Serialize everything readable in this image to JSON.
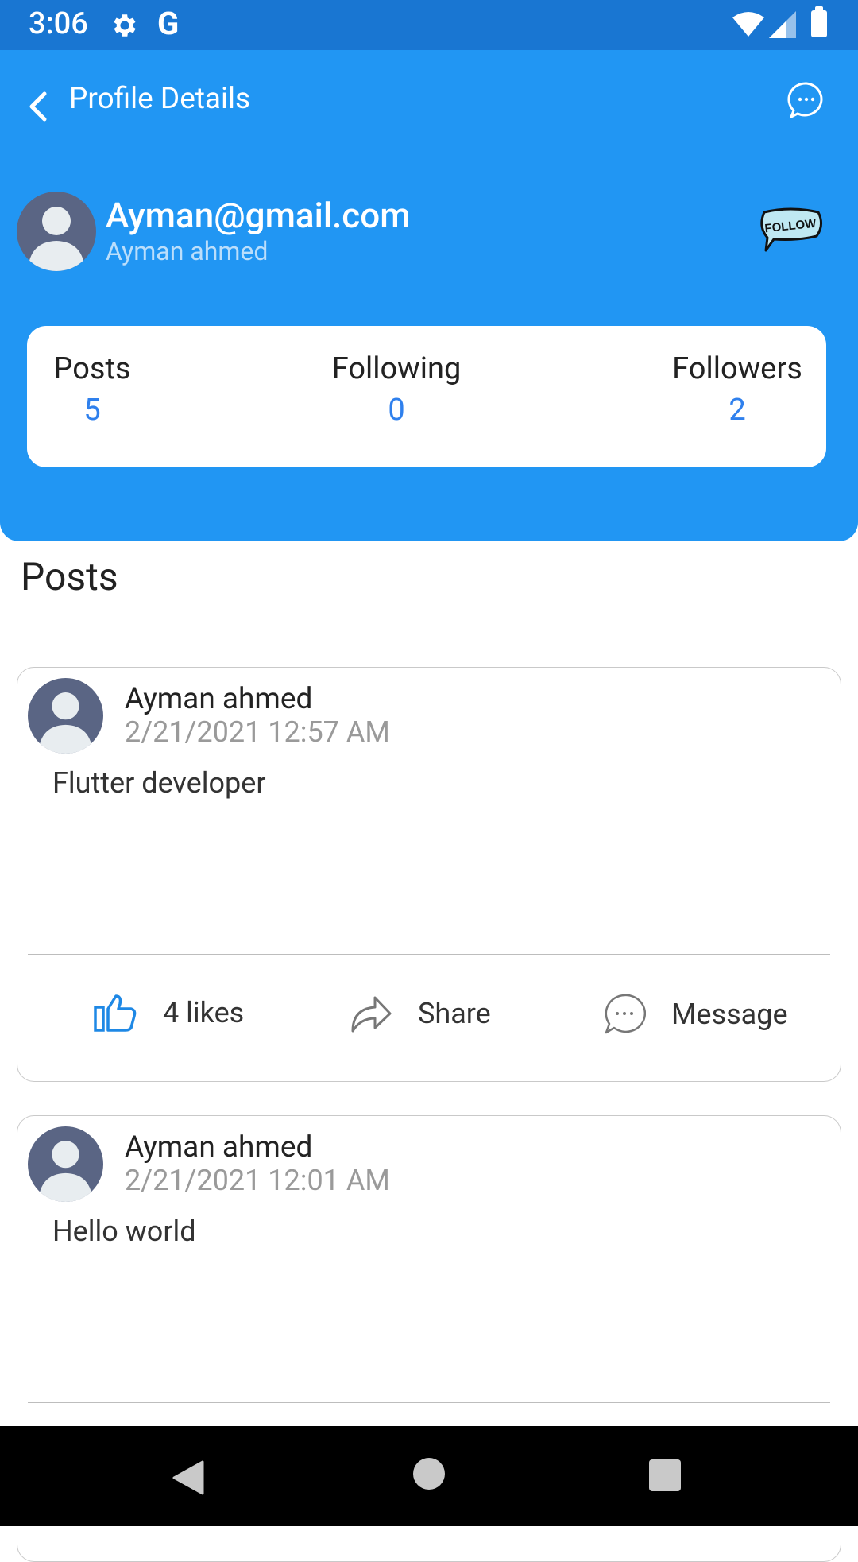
{
  "status_bar": {
    "time": "3:06",
    "g_label": "G"
  },
  "header": {
    "title": "Profile Details"
  },
  "profile": {
    "email": "Ayman@gmail.com",
    "name": "Ayman ahmed",
    "follow_label": "FOLLOW"
  },
  "stats": [
    {
      "label": "Posts",
      "value": "5"
    },
    {
      "label": "Following",
      "value": "0"
    },
    {
      "label": "Followers",
      "value": "2"
    }
  ],
  "posts_section_title": "Posts",
  "posts": [
    {
      "author": "Ayman ahmed",
      "date": "2/21/2021 12:57 AM",
      "content": "Flutter developer",
      "likes_label": "4 likes",
      "share_label": "Share",
      "message_label": "Message"
    },
    {
      "author": "Ayman ahmed",
      "date": "2/21/2021 12:01 AM",
      "content": "Hello world"
    }
  ],
  "colors": {
    "status_bar": "#1976D2",
    "header": "#2196F3",
    "accent": "#2F80ED",
    "avatar": "#5A6584"
  },
  "icons": [
    "gear-icon",
    "wifi-icon",
    "signal-icon",
    "battery-icon",
    "back-arrow-icon",
    "chat-bubble-icon",
    "follow-sticker-icon",
    "thumbs-up-icon",
    "share-icon",
    "message-icon"
  ]
}
